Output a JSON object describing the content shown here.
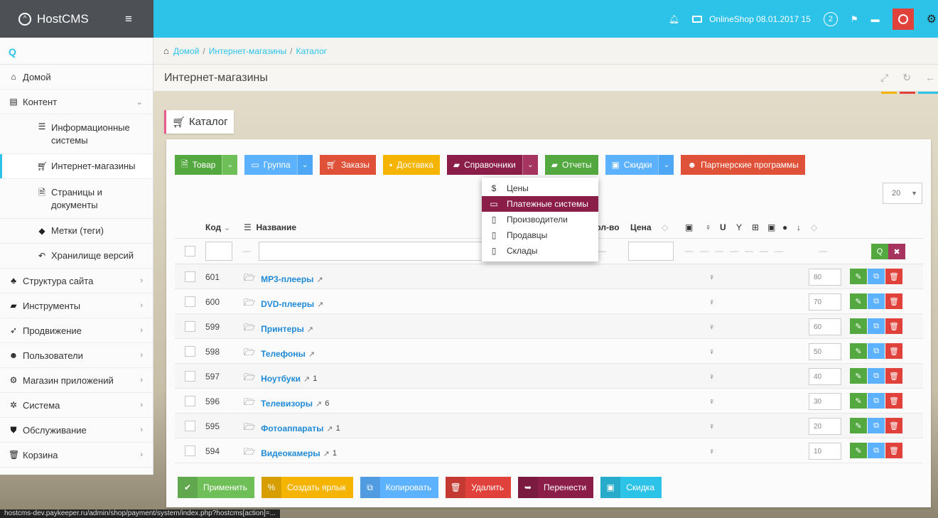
{
  "app": {
    "brand": "HostCMS",
    "shop_label": "OnlineShop 08.01.2017 15",
    "notification_count": "2"
  },
  "sidebar": {
    "items": [
      {
        "label": "Домой",
        "icon": "home-icon"
      },
      {
        "label": "Контент",
        "icon": "content-icon"
      },
      {
        "label": "Информационные системы",
        "icon": "list-icon"
      },
      {
        "label": "Интернет-магазины",
        "icon": "cart-icon"
      },
      {
        "label": "Страницы и документы",
        "icon": "document-icon"
      },
      {
        "label": "Метки (теги)",
        "icon": "tags-icon"
      },
      {
        "label": "Хранилище версий",
        "icon": "history-icon"
      },
      {
        "label": "Структура сайта",
        "icon": "sitemap-icon"
      },
      {
        "label": "Инструменты",
        "icon": "toolbox-icon"
      },
      {
        "label": "Продвижение",
        "icon": "rocket-icon"
      },
      {
        "label": "Пользователи",
        "icon": "users-icon"
      },
      {
        "label": "Магазин приложений",
        "icon": "cogs-icon"
      },
      {
        "label": "Система",
        "icon": "gear-icon"
      },
      {
        "label": "Обслуживание",
        "icon": "shield-icon"
      },
      {
        "label": "Корзина",
        "icon": "trash-icon"
      }
    ]
  },
  "breadcrumb": [
    "Домой",
    "Интернет-магазины",
    "Каталог"
  ],
  "page_title": "Интернет-магазины",
  "tab_label": "Каталог",
  "toolbar": {
    "product": "Товар",
    "group": "Группа",
    "orders": "Заказы",
    "delivery": "Доставка",
    "directories": "Справочники",
    "reports": "Отчеты",
    "discounts": "Скидки",
    "partners": "Партнерские программы"
  },
  "dropdown": [
    {
      "label": "Цены",
      "active": false
    },
    {
      "label": "Платежные системы",
      "active": true
    },
    {
      "label": "Производители",
      "active": false
    },
    {
      "label": "Продавцы",
      "active": false
    },
    {
      "label": "Склады",
      "active": false
    }
  ],
  "per_page": "20",
  "table": {
    "headers": {
      "code": "Код",
      "name": "Название",
      "qty": "Кол-во",
      "price": "Цена"
    },
    "rows": [
      {
        "code": "601",
        "name": "MP3-плееры",
        "count": "",
        "sort": "80"
      },
      {
        "code": "600",
        "name": "DVD-плееры",
        "count": "",
        "sort": "70"
      },
      {
        "code": "599",
        "name": "Принтеры",
        "count": "",
        "sort": "60"
      },
      {
        "code": "598",
        "name": "Телефоны",
        "count": "",
        "sort": "50"
      },
      {
        "code": "597",
        "name": "Ноутбуки",
        "count": "1",
        "sort": "40"
      },
      {
        "code": "596",
        "name": "Телевизоры",
        "count": "6",
        "sort": "30"
      },
      {
        "code": "595",
        "name": "Фотоаппараты",
        "count": "1",
        "sort": "20"
      },
      {
        "code": "594",
        "name": "Видеокамеры",
        "count": "1",
        "sort": "10"
      }
    ]
  },
  "actions": {
    "apply": "Применить",
    "shortcut": "Создать ярлык",
    "copy": "Копировать",
    "delete": "Удалить",
    "move": "Перенести",
    "discount": "Скидка"
  },
  "status_url": "hostcms-dev.paykeeper.ru/admin/shop/payment/system/index.php?hostcms[action]=...",
  "colors": {
    "accent": "#2dc3e8",
    "maroon": "#8b1e48",
    "green": "#53a93f",
    "blue": "#5db2ff",
    "red": "#df5138",
    "yellow": "#f4b400"
  }
}
